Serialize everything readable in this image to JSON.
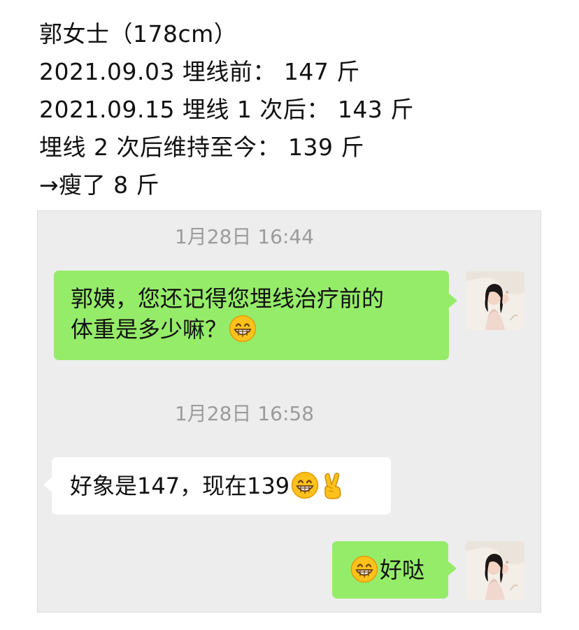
{
  "header": {
    "lines": [
      "郭女士（178cm）",
      "2021.09.03 埋线前：  147 斤",
      "2021.09.15 埋线 1 次后：  143 斤",
      "埋线 2 次后维持至今：  139 斤",
      "→瘦了 8 斤"
    ]
  },
  "chat": {
    "timestamps": [
      "1月28日 16:44",
      "1月28日 16:58"
    ],
    "messages": [
      {
        "side": "right",
        "color": "#95ec69",
        "lines": [
          "郭姨，您还记得您埋线治疗前的",
          "体重是多少嘛？"
        ],
        "trailing_icon": "grinning-face-emoji"
      },
      {
        "side": "left",
        "color": "#ffffff",
        "text": "好象是147，现在139",
        "trailing_icons": [
          "grinning-face-emoji",
          "victory-hand-emoji"
        ]
      },
      {
        "side": "right",
        "color": "#95ec69",
        "text": "好哒",
        "leading_icon": "grinning-face-emoji"
      }
    ]
  },
  "colors": {
    "sent_bubble": "#95ec69",
    "received_bubble": "#ffffff",
    "chat_background": "#ededed",
    "timestamp_text": "#9b9b9b"
  }
}
